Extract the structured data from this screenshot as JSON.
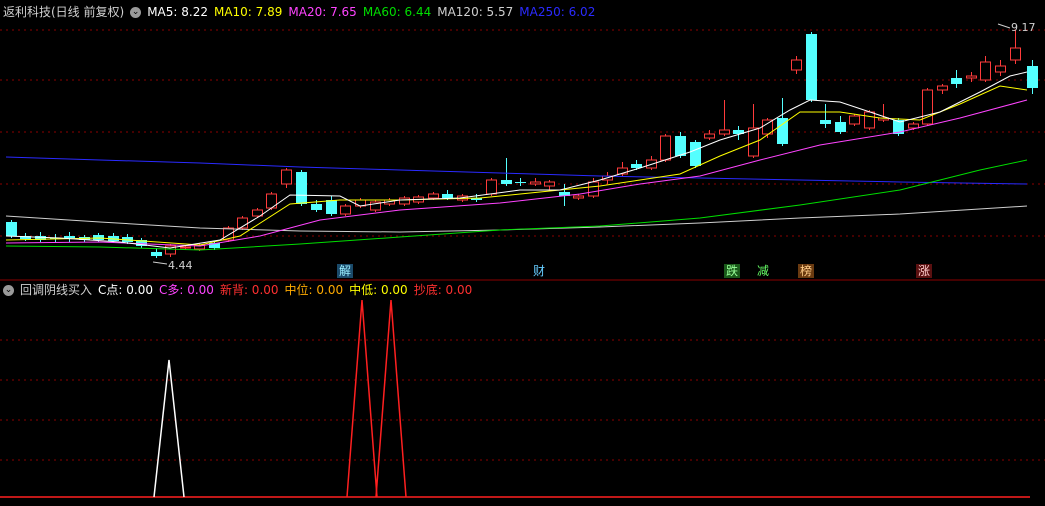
{
  "main_header": {
    "title": "返利科技(日线 前复权)",
    "ma5": "MA5: 8.22",
    "ma10": "MA10: 7.89",
    "ma20": "MA20: 7.65",
    "ma60": "MA60: 6.44",
    "ma120": "MA120: 5.57",
    "ma250": "MA250: 6.02"
  },
  "price_labels": {
    "high": "9.17",
    "low": "4.44"
  },
  "event_tags": [
    "解",
    "财",
    "跌",
    "减",
    "榜",
    "涨"
  ],
  "indicator_header": {
    "title": "回调阴线买入",
    "c_point": "C点: 0.00",
    "c_duo": "C多: 0.00",
    "xin_bei": "新背: 0.00",
    "zhong_wei": "中位: 0.00",
    "zhong_di": "中低: 0.00",
    "chao_di": "抄底: 0.00"
  },
  "colors": {
    "up": "#ff3b3b",
    "down": "#54ffff",
    "ma5": "#ffffff",
    "ma10": "#ffff00",
    "ma20": "#ff44ff",
    "ma60": "#00dd00",
    "ma120": "#cfcfcf",
    "ma250": "#2a2aff",
    "grid": "#8b0000"
  },
  "chart_data": {
    "type": "candlestick",
    "ma_series": [
      "MA5",
      "MA10",
      "MA20",
      "MA60",
      "MA120",
      "MA250"
    ],
    "price_high": 9.17,
    "price_low": 4.44,
    "indicator_signals": [
      {
        "name": "C点",
        "color": "white",
        "peaks": 1
      },
      {
        "name": "抄底",
        "color": "red",
        "peaks": 2
      }
    ]
  }
}
